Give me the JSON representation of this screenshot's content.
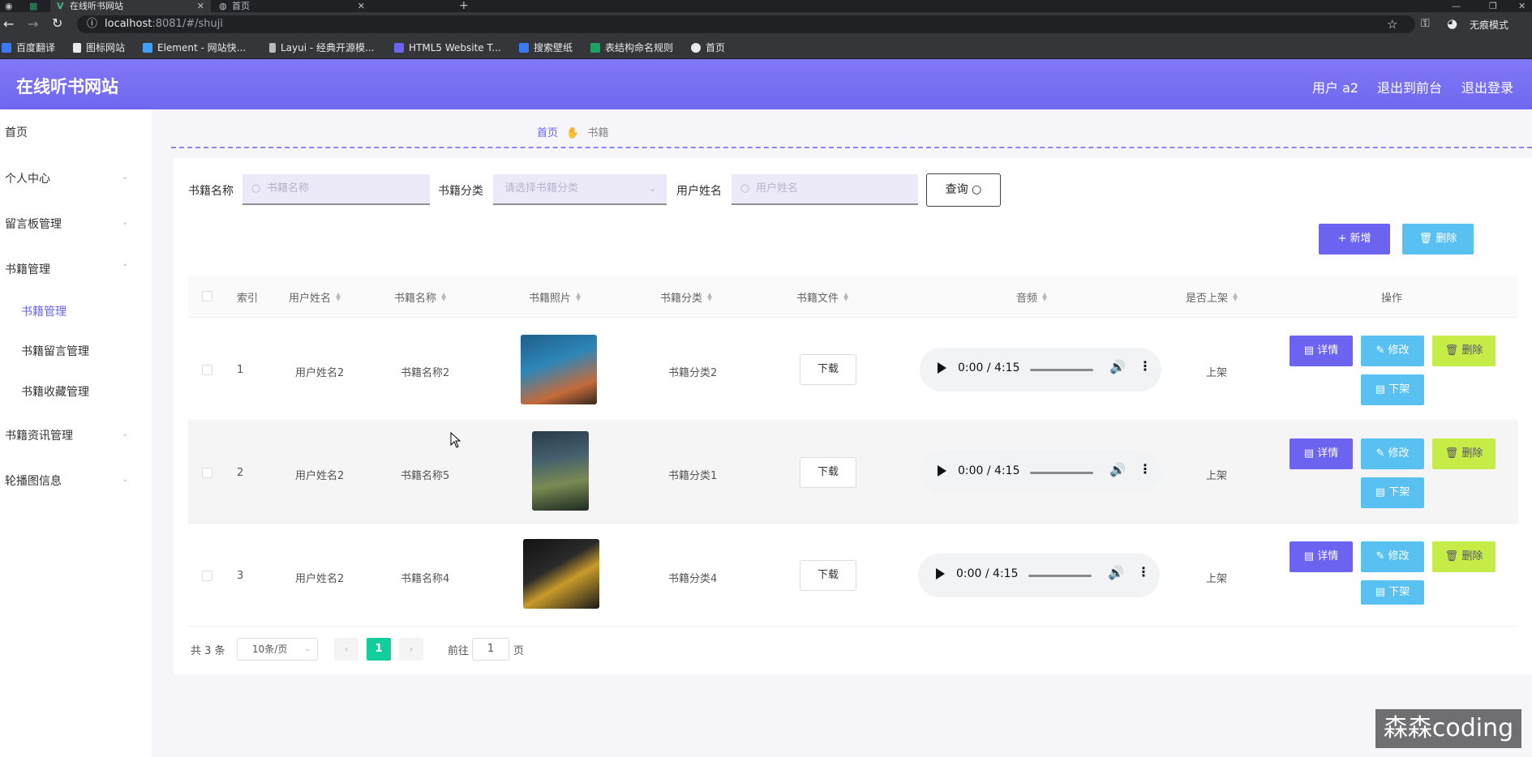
{
  "browser": {
    "tabs": [
      {
        "label": "在线听书网站",
        "close": "✕"
      },
      {
        "label": "首页",
        "close": "✕"
      }
    ],
    "new_tab": "+",
    "url_host": "localhost",
    "url_path": ":8081/#/shuji",
    "incognito_label": "无痕模式",
    "bookmarks": [
      "百度翻译",
      "图标网站",
      "Element - 网站快...",
      "Layui - 经典开源模...",
      "HTML5 Website T...",
      "搜索壁纸",
      "表结构命名规则",
      "首页"
    ]
  },
  "header": {
    "site_title": "在线听书网站",
    "user": "用户 a2",
    "back_front": "退出到前台",
    "logout": "退出登录"
  },
  "sidebar": {
    "items": [
      "首页",
      "个人中心",
      "留言板管理",
      "书籍管理",
      "书籍资讯管理",
      "轮播图信息"
    ],
    "subitems": [
      "书籍管理",
      "书籍留言管理",
      "书籍收藏管理"
    ],
    "active": "书籍管理"
  },
  "breadcrumb": {
    "home": "首页",
    "current": "书籍"
  },
  "search": {
    "name_label": "书籍名称",
    "name_placeholder": "书籍名称",
    "category_label": "书籍分类",
    "category_placeholder": "请选择书籍分类",
    "user_label": "用户姓名",
    "user_placeholder": "用户姓名",
    "query_button": "查询"
  },
  "toolbar": {
    "add": "+ 新增",
    "delete": "删除"
  },
  "table": {
    "columns": [
      "索引",
      "用户姓名",
      "书籍名称",
      "书籍照片",
      "书籍分类",
      "书籍文件",
      "音频",
      "是否上架",
      "操作"
    ],
    "rows": [
      {
        "index": "1",
        "user": "用户姓名2",
        "name": "书籍名称2",
        "category": "书籍分类2",
        "file": "下载",
        "audio_time": "0:00 / 4:15",
        "status": "上架"
      },
      {
        "index": "2",
        "user": "用户姓名2",
        "name": "书籍名称5",
        "category": "书籍分类1",
        "file": "下载",
        "audio_time": "0:00 / 4:15",
        "status": "上架"
      },
      {
        "index": "3",
        "user": "用户姓名2",
        "name": "书籍名称4",
        "category": "书籍分类4",
        "file": "下载",
        "audio_time": "0:00 / 4:15",
        "status": "上架"
      }
    ],
    "actions": {
      "detail": "详情",
      "edit": "修改",
      "delete": "删除",
      "off": "下架"
    }
  },
  "pagination": {
    "total": "共 3 条",
    "page_size": "10条/页",
    "current": "1",
    "goto_prefix": "前往",
    "goto_value": "1",
    "goto_suffix": "页"
  },
  "watermark": "森森coding",
  "colors": {
    "accent": "#6c63f0",
    "header": "#7b74f2",
    "current_page": "#13ce9c",
    "edit": "#58c1f2",
    "delete": "#c6ec48"
  }
}
